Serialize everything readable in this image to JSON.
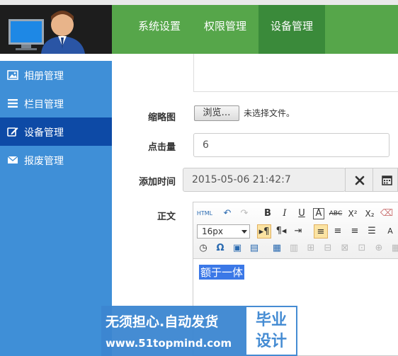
{
  "nav": {
    "tabs": [
      "系统设置",
      "权限管理",
      "设备管理"
    ],
    "active_tab": "设备管理"
  },
  "sidebar": {
    "items": [
      {
        "label": "相册管理",
        "icon": "image-icon"
      },
      {
        "label": "栏目管理",
        "icon": "list-icon"
      },
      {
        "label": "设备管理",
        "icon": "edit-icon"
      },
      {
        "label": "报废管理",
        "icon": "envelope-icon"
      }
    ],
    "active_item": "设备管理"
  },
  "form": {
    "thumbnail_label": "缩略图",
    "file_button": "浏览…",
    "file_status": "未选择文件。",
    "clicks_label": "点击量",
    "clicks_value": "6",
    "add_time_label": "添加时间",
    "add_time_value": "2015-05-06 21:42:7",
    "body_label": "正文"
  },
  "editor": {
    "html_label": "HTML",
    "font_size": "16px",
    "content": "额于一体"
  },
  "watermark": {
    "main": "无须担心.自动发货",
    "url": "www.51topmind.com",
    "box_line1": "毕业",
    "box_line2": "设计"
  },
  "colors": {
    "nav_bg": "#56a64a",
    "nav_active": "#3a8a3a",
    "sidebar_bg": "#3f8fd7",
    "sidebar_active": "#0d4aa6",
    "selection": "#3b78e7"
  }
}
